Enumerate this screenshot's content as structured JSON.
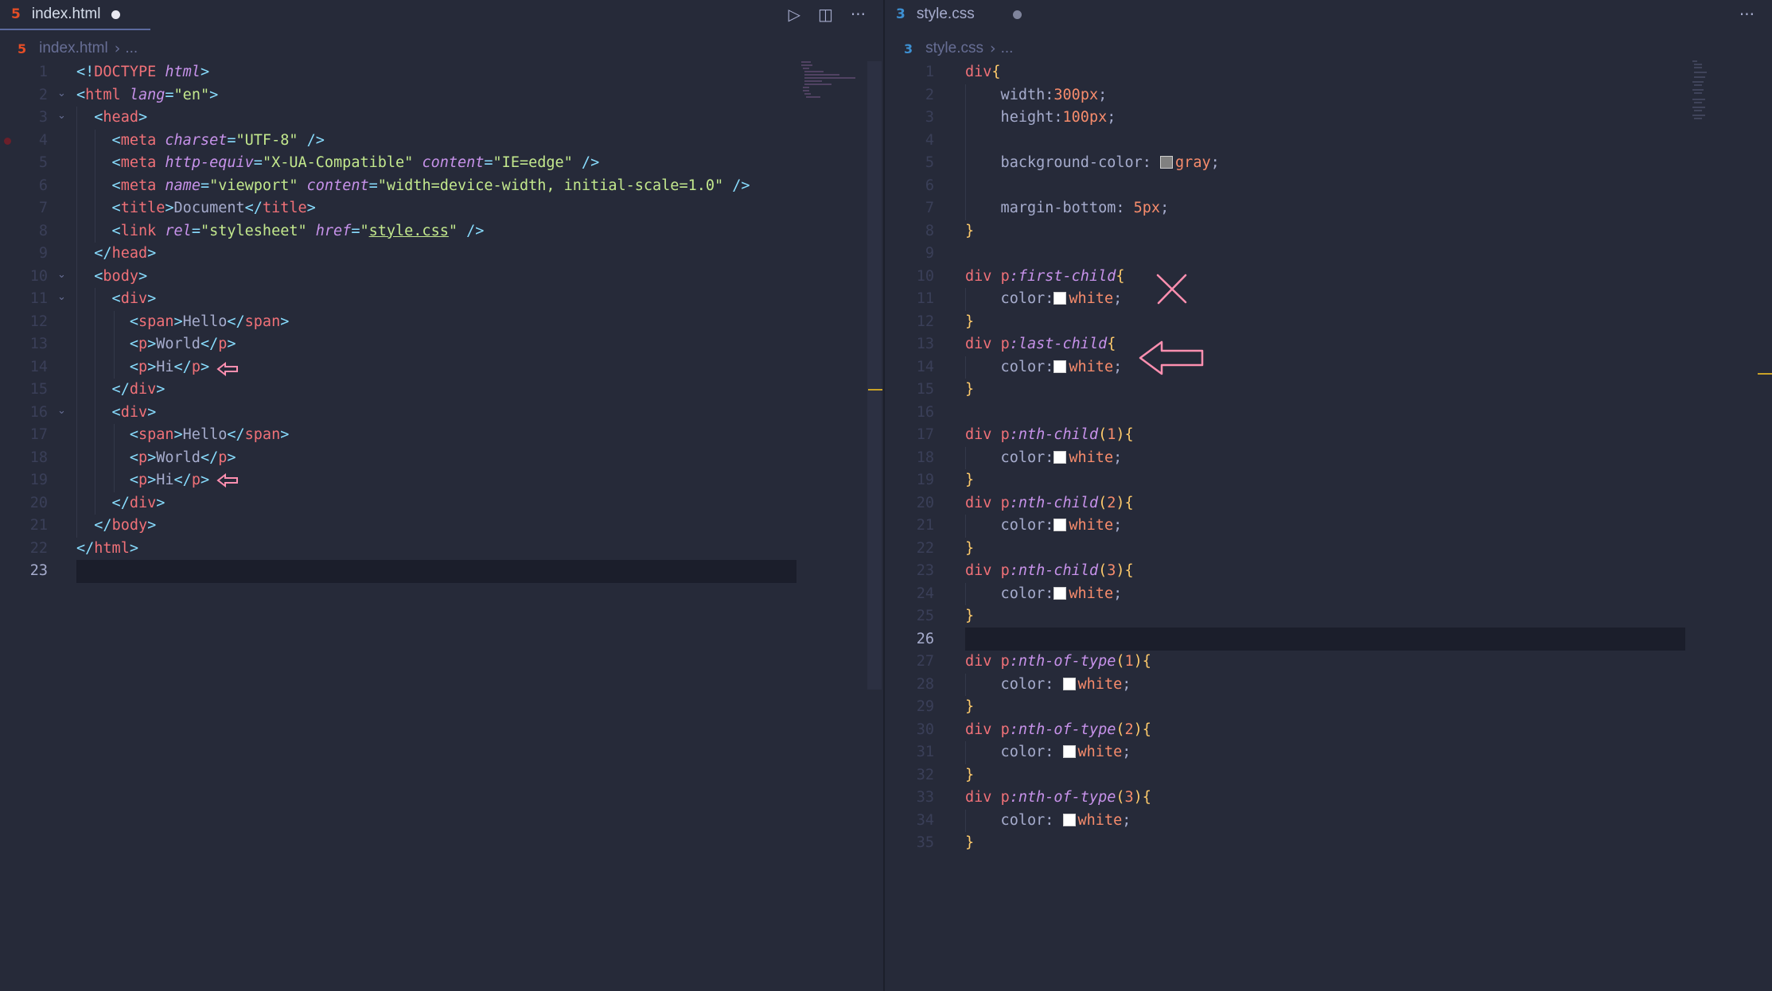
{
  "left_editor": {
    "tab": {
      "label": "index.html",
      "icon": "html5-icon"
    },
    "breadcrumb": {
      "file": "index.html",
      "more": "..."
    },
    "current_line": "23",
    "lines": [
      {
        "n": "1",
        "s": [
          [
            "<!",
            "p"
          ],
          [
            "DOCTYPE ",
            "t"
          ],
          [
            "html",
            "a"
          ],
          [
            ">",
            "p"
          ]
        ]
      },
      {
        "n": "2",
        "s": [
          [
            "<",
            "p"
          ],
          [
            "html ",
            "t"
          ],
          [
            "lang",
            "a"
          ],
          [
            "=",
            "p"
          ],
          [
            "\"en\"",
            "s"
          ],
          [
            ">",
            "p"
          ]
        ]
      },
      {
        "n": "3",
        "s": [
          [
            "  <",
            "p"
          ],
          [
            "head",
            "t"
          ],
          [
            ">",
            "p"
          ]
        ]
      },
      {
        "n": "4",
        "s": [
          [
            "    <",
            "p"
          ],
          [
            "meta ",
            "t"
          ],
          [
            "charset",
            "a"
          ],
          [
            "=",
            "p"
          ],
          [
            "\"UTF-8\"",
            "s"
          ],
          [
            " />",
            "p"
          ]
        ]
      },
      {
        "n": "5",
        "s": [
          [
            "    <",
            "p"
          ],
          [
            "meta ",
            "t"
          ],
          [
            "http-equiv",
            "a"
          ],
          [
            "=",
            "p"
          ],
          [
            "\"X-UA-Compatible\"",
            "s"
          ],
          [
            " ",
            "w"
          ],
          [
            "content",
            "a"
          ],
          [
            "=",
            "p"
          ],
          [
            "\"IE=edge\"",
            "s"
          ],
          [
            " />",
            "p"
          ]
        ]
      },
      {
        "n": "6",
        "s": [
          [
            "    <",
            "p"
          ],
          [
            "meta ",
            "t"
          ],
          [
            "name",
            "a"
          ],
          [
            "=",
            "p"
          ],
          [
            "\"viewport\"",
            "s"
          ],
          [
            " ",
            "w"
          ],
          [
            "content",
            "a"
          ],
          [
            "=",
            "p"
          ],
          [
            "\"width=device-width, initial-scale=1.0\"",
            "s"
          ],
          [
            " />",
            "p"
          ]
        ]
      },
      {
        "n": "7",
        "s": [
          [
            "    <",
            "p"
          ],
          [
            "title",
            "t"
          ],
          [
            ">",
            "p"
          ],
          [
            "Document",
            "w"
          ],
          [
            "</",
            "p"
          ],
          [
            "title",
            "t"
          ],
          [
            ">",
            "p"
          ]
        ]
      },
      {
        "n": "8",
        "s": [
          [
            "    <",
            "p"
          ],
          [
            "link ",
            "t"
          ],
          [
            "rel",
            "a"
          ],
          [
            "=",
            "p"
          ],
          [
            "\"stylesheet\"",
            "s"
          ],
          [
            " ",
            "w"
          ],
          [
            "href",
            "a"
          ],
          [
            "=",
            "p"
          ],
          [
            "\"",
            "s"
          ],
          [
            "style.css",
            "su"
          ],
          [
            "\"",
            "s"
          ],
          [
            " />",
            "p"
          ]
        ]
      },
      {
        "n": "9",
        "s": [
          [
            "  </",
            "p"
          ],
          [
            "head",
            "t"
          ],
          [
            ">",
            "p"
          ]
        ]
      },
      {
        "n": "10",
        "s": [
          [
            "  <",
            "p"
          ],
          [
            "body",
            "t"
          ],
          [
            ">",
            "p"
          ]
        ]
      },
      {
        "n": "11",
        "s": [
          [
            "    <",
            "p"
          ],
          [
            "div",
            "t"
          ],
          [
            ">",
            "p"
          ]
        ]
      },
      {
        "n": "12",
        "s": [
          [
            "      <",
            "p"
          ],
          [
            "span",
            "t"
          ],
          [
            ">",
            "p"
          ],
          [
            "Hello",
            "w"
          ],
          [
            "</",
            "p"
          ],
          [
            "span",
            "t"
          ],
          [
            ">",
            "p"
          ]
        ]
      },
      {
        "n": "13",
        "s": [
          [
            "      <",
            "p"
          ],
          [
            "p",
            "t"
          ],
          [
            ">",
            "p"
          ],
          [
            "World",
            "w"
          ],
          [
            "</",
            "p"
          ],
          [
            "p",
            "t"
          ],
          [
            ">",
            "p"
          ]
        ]
      },
      {
        "n": "14",
        "s": [
          [
            "      <",
            "p"
          ],
          [
            "p",
            "t"
          ],
          [
            ">",
            "p"
          ],
          [
            "Hi",
            "w"
          ],
          [
            "</",
            "p"
          ],
          [
            "p",
            "t"
          ],
          [
            ">",
            "p"
          ]
        ]
      },
      {
        "n": "15",
        "s": [
          [
            "    </",
            "p"
          ],
          [
            "div",
            "t"
          ],
          [
            ">",
            "p"
          ]
        ]
      },
      {
        "n": "16",
        "s": [
          [
            "    <",
            "p"
          ],
          [
            "div",
            "t"
          ],
          [
            ">",
            "p"
          ]
        ]
      },
      {
        "n": "17",
        "s": [
          [
            "      <",
            "p"
          ],
          [
            "span",
            "t"
          ],
          [
            ">",
            "p"
          ],
          [
            "Hello",
            "w"
          ],
          [
            "</",
            "p"
          ],
          [
            "span",
            "t"
          ],
          [
            ">",
            "p"
          ]
        ]
      },
      {
        "n": "18",
        "s": [
          [
            "      <",
            "p"
          ],
          [
            "p",
            "t"
          ],
          [
            ">",
            "p"
          ],
          [
            "World",
            "w"
          ],
          [
            "</",
            "p"
          ],
          [
            "p",
            "t"
          ],
          [
            ">",
            "p"
          ]
        ]
      },
      {
        "n": "19",
        "s": [
          [
            "      <",
            "p"
          ],
          [
            "p",
            "t"
          ],
          [
            ">",
            "p"
          ],
          [
            "Hi",
            "w"
          ],
          [
            "</",
            "p"
          ],
          [
            "p",
            "t"
          ],
          [
            ">",
            "p"
          ]
        ]
      },
      {
        "n": "20",
        "s": [
          [
            "    </",
            "p"
          ],
          [
            "div",
            "t"
          ],
          [
            ">",
            "p"
          ]
        ]
      },
      {
        "n": "21",
        "s": [
          [
            "  </",
            "p"
          ],
          [
            "body",
            "t"
          ],
          [
            ">",
            "p"
          ]
        ]
      },
      {
        "n": "22",
        "s": [
          [
            "</",
            "p"
          ],
          [
            "html",
            "t"
          ],
          [
            ">",
            "p"
          ]
        ]
      },
      {
        "n": "23",
        "s": []
      }
    ],
    "fold_lines": [
      "2",
      "3",
      "10",
      "11",
      "16"
    ],
    "breakpoint_line": "4"
  },
  "right_editor": {
    "tab": {
      "label": "style.css",
      "icon": "css3-icon"
    },
    "breadcrumb": {
      "file": "style.css",
      "more": "..."
    },
    "current_line": "26",
    "lines": [
      {
        "n": "1",
        "s": [
          [
            "div",
            "sel"
          ],
          [
            "{",
            "br"
          ]
        ]
      },
      {
        "n": "2",
        "s": [
          [
            "    width",
            "pr"
          ],
          [
            ":",
            "w"
          ],
          [
            "300",
            "num"
          ],
          [
            "px",
            "unit"
          ],
          [
            ";",
            "w"
          ]
        ]
      },
      {
        "n": "3",
        "s": [
          [
            "    height",
            "pr"
          ],
          [
            ":",
            "w"
          ],
          [
            "100",
            "num"
          ],
          [
            "px",
            "unit"
          ],
          [
            ";",
            "w"
          ]
        ]
      },
      {
        "n": "4",
        "s": []
      },
      {
        "n": "5",
        "s": [
          [
            "    background-color",
            "pr"
          ],
          [
            ": ",
            "w"
          ],
          [
            "#gray",
            "sw"
          ],
          [
            "gray",
            "val"
          ],
          [
            ";",
            "w"
          ]
        ]
      },
      {
        "n": "6",
        "s": []
      },
      {
        "n": "7",
        "s": [
          [
            "    margin-bottom",
            "pr"
          ],
          [
            ": ",
            "w"
          ],
          [
            "5",
            "num"
          ],
          [
            "px",
            "unit"
          ],
          [
            ";",
            "w"
          ]
        ]
      },
      {
        "n": "8",
        "s": [
          [
            "}",
            "br"
          ]
        ]
      },
      {
        "n": "9",
        "s": []
      },
      {
        "n": "10",
        "s": [
          [
            "div ",
            "sel"
          ],
          [
            "p",
            "sel"
          ],
          [
            ":",
            "pc"
          ],
          [
            "first-child",
            "pc"
          ],
          [
            "{",
            "br"
          ]
        ]
      },
      {
        "n": "11",
        "s": [
          [
            "    color",
            "pr"
          ],
          [
            ":",
            "w"
          ],
          [
            "#white",
            "sw"
          ],
          [
            "white",
            "val"
          ],
          [
            ";",
            "w"
          ]
        ]
      },
      {
        "n": "12",
        "s": [
          [
            "}",
            "br"
          ]
        ]
      },
      {
        "n": "13",
        "s": [
          [
            "div ",
            "sel"
          ],
          [
            "p",
            "sel"
          ],
          [
            ":",
            "pc"
          ],
          [
            "last-child",
            "pc"
          ],
          [
            "{",
            "br"
          ]
        ]
      },
      {
        "n": "14",
        "s": [
          [
            "    color",
            "pr"
          ],
          [
            ":",
            "w"
          ],
          [
            "#white",
            "sw"
          ],
          [
            "white",
            "val"
          ],
          [
            ";",
            "w"
          ]
        ]
      },
      {
        "n": "15",
        "s": [
          [
            "}",
            "br"
          ]
        ]
      },
      {
        "n": "16",
        "s": []
      },
      {
        "n": "17",
        "s": [
          [
            "div ",
            "sel"
          ],
          [
            "p",
            "sel"
          ],
          [
            ":",
            "pc"
          ],
          [
            "nth-child",
            "pc"
          ],
          [
            "(",
            "br"
          ],
          [
            "1",
            "num"
          ],
          [
            ")",
            "br"
          ],
          [
            "{",
            "br"
          ]
        ]
      },
      {
        "n": "18",
        "s": [
          [
            "    color",
            "pr"
          ],
          [
            ":",
            "w"
          ],
          [
            "#white",
            "sw"
          ],
          [
            "white",
            "val"
          ],
          [
            ";",
            "w"
          ]
        ]
      },
      {
        "n": "19",
        "s": [
          [
            "}",
            "br"
          ]
        ]
      },
      {
        "n": "20",
        "s": [
          [
            "div ",
            "sel"
          ],
          [
            "p",
            "sel"
          ],
          [
            ":",
            "pc"
          ],
          [
            "nth-child",
            "pc"
          ],
          [
            "(",
            "br"
          ],
          [
            "2",
            "num"
          ],
          [
            ")",
            "br"
          ],
          [
            "{",
            "br"
          ]
        ]
      },
      {
        "n": "21",
        "s": [
          [
            "    color",
            "pr"
          ],
          [
            ":",
            "w"
          ],
          [
            "#white",
            "sw"
          ],
          [
            "white",
            "val"
          ],
          [
            ";",
            "w"
          ]
        ]
      },
      {
        "n": "22",
        "s": [
          [
            "}",
            "br"
          ]
        ]
      },
      {
        "n": "23",
        "s": [
          [
            "div ",
            "sel"
          ],
          [
            "p",
            "sel"
          ],
          [
            ":",
            "pc"
          ],
          [
            "nth-child",
            "pc"
          ],
          [
            "(",
            "br"
          ],
          [
            "3",
            "num"
          ],
          [
            ")",
            "br"
          ],
          [
            "{",
            "br"
          ]
        ]
      },
      {
        "n": "24",
        "s": [
          [
            "    color",
            "pr"
          ],
          [
            ":",
            "w"
          ],
          [
            "#white",
            "sw"
          ],
          [
            "white",
            "val"
          ],
          [
            ";",
            "w"
          ]
        ]
      },
      {
        "n": "25",
        "s": [
          [
            "}",
            "br"
          ]
        ]
      },
      {
        "n": "26",
        "s": []
      },
      {
        "n": "27",
        "s": [
          [
            "div ",
            "sel"
          ],
          [
            "p",
            "sel"
          ],
          [
            ":",
            "pc"
          ],
          [
            "nth-of-type",
            "pc"
          ],
          [
            "(",
            "br"
          ],
          [
            "1",
            "num"
          ],
          [
            ")",
            "br"
          ],
          [
            "{",
            "br"
          ]
        ]
      },
      {
        "n": "28",
        "s": [
          [
            "    color",
            "pr"
          ],
          [
            ": ",
            "w"
          ],
          [
            "#white",
            "sw"
          ],
          [
            "white",
            "val"
          ],
          [
            ";",
            "w"
          ]
        ]
      },
      {
        "n": "29",
        "s": [
          [
            "}",
            "br"
          ]
        ]
      },
      {
        "n": "30",
        "s": [
          [
            "div ",
            "sel"
          ],
          [
            "p",
            "sel"
          ],
          [
            ":",
            "pc"
          ],
          [
            "nth-of-type",
            "pc"
          ],
          [
            "(",
            "br"
          ],
          [
            "2",
            "num"
          ],
          [
            ")",
            "br"
          ],
          [
            "{",
            "br"
          ]
        ]
      },
      {
        "n": "31",
        "s": [
          [
            "    color",
            "pr"
          ],
          [
            ": ",
            "w"
          ],
          [
            "#white",
            "sw"
          ],
          [
            "white",
            "val"
          ],
          [
            ";",
            "w"
          ]
        ]
      },
      {
        "n": "32",
        "s": [
          [
            "}",
            "br"
          ]
        ]
      },
      {
        "n": "33",
        "s": [
          [
            "div ",
            "sel"
          ],
          [
            "p",
            "sel"
          ],
          [
            ":",
            "pc"
          ],
          [
            "nth-of-type",
            "pc"
          ],
          [
            "(",
            "br"
          ],
          [
            "3",
            "num"
          ],
          [
            ")",
            "br"
          ],
          [
            "{",
            "br"
          ]
        ]
      },
      {
        "n": "34",
        "s": [
          [
            "    color",
            "pr"
          ],
          [
            ": ",
            "w"
          ],
          [
            "#white",
            "sw"
          ],
          [
            "white",
            "val"
          ],
          [
            ";",
            "w"
          ]
        ]
      },
      {
        "n": "35",
        "s": [
          [
            "}",
            "br"
          ]
        ]
      }
    ]
  },
  "colors": {
    "background": "#262a39",
    "tag": "#f07178",
    "punctuation": "#89ddff",
    "attribute": "#c792ea",
    "string": "#c3e88d",
    "number": "#f78c6c",
    "brace": "#ffcb6b",
    "annotation": "#ff8fb0"
  },
  "icons": {
    "run": "play-icon",
    "split": "split-editor-icon",
    "more": "more-actions-icon"
  }
}
